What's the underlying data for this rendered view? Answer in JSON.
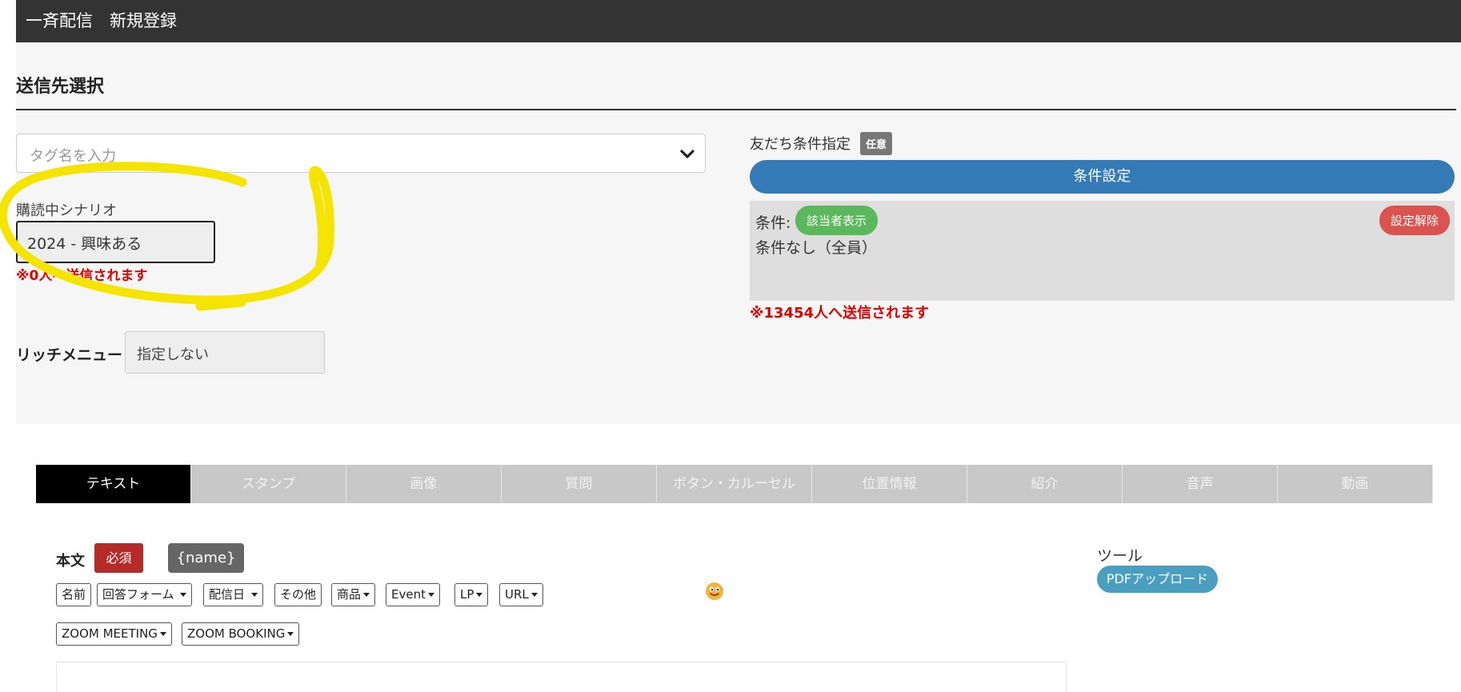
{
  "header": {
    "title": "一斉配信　新規登録"
  },
  "recipients": {
    "section_title": "送信先選択",
    "tag_select": {
      "placeholder": "タグ名を入力"
    },
    "scenario": {
      "label": "購読中シナリオ",
      "value": "2024 - 興味ある",
      "warning": "※0人へ送信されます"
    },
    "rich_menu": {
      "label": "リッチメニュー",
      "value": "指定しない"
    }
  },
  "friend_conditions": {
    "label": "友だち条件指定",
    "optional_badge": "任意",
    "set_button": "条件設定",
    "conditions_label": "条件:",
    "show_matches_button": "該当者表示",
    "clear_button": "設定解除",
    "conditions_text": "条件なし（全員）",
    "warning": "※13454人へ送信されます"
  },
  "tabs": [
    {
      "label": "テキスト",
      "active": true
    },
    {
      "label": "スタンプ"
    },
    {
      "label": "画像"
    },
    {
      "label": "質問"
    },
    {
      "label": "ボタン・カルーセル"
    },
    {
      "label": "位置情報"
    },
    {
      "label": "紹介"
    },
    {
      "label": "音声"
    },
    {
      "label": "動画"
    }
  ],
  "editor": {
    "body_label": "本文",
    "required_badge": "必須",
    "name_tag": "{name}",
    "toolbar": {
      "name": "名前",
      "answer_form": "回答フォーム",
      "send_date": "配信日",
      "other": "その他",
      "product": "商品",
      "event": "Event",
      "lp": "LP",
      "url": "URL",
      "zoom_meeting": "ZOOM MEETING",
      "zoom_booking": "ZOOM BOOKING"
    },
    "emoji_icon": "smiley-emoji-icon"
  },
  "tools": {
    "label": "ツール",
    "pdf_upload": "PDFアップロード"
  },
  "colors": {
    "header_bg": "#333333",
    "primary": "#337ab7",
    "success": "#5cb85c",
    "danger": "#d9534f",
    "required": "#b52b27",
    "info": "#4a9fc0",
    "highlight": "#f5e400"
  }
}
